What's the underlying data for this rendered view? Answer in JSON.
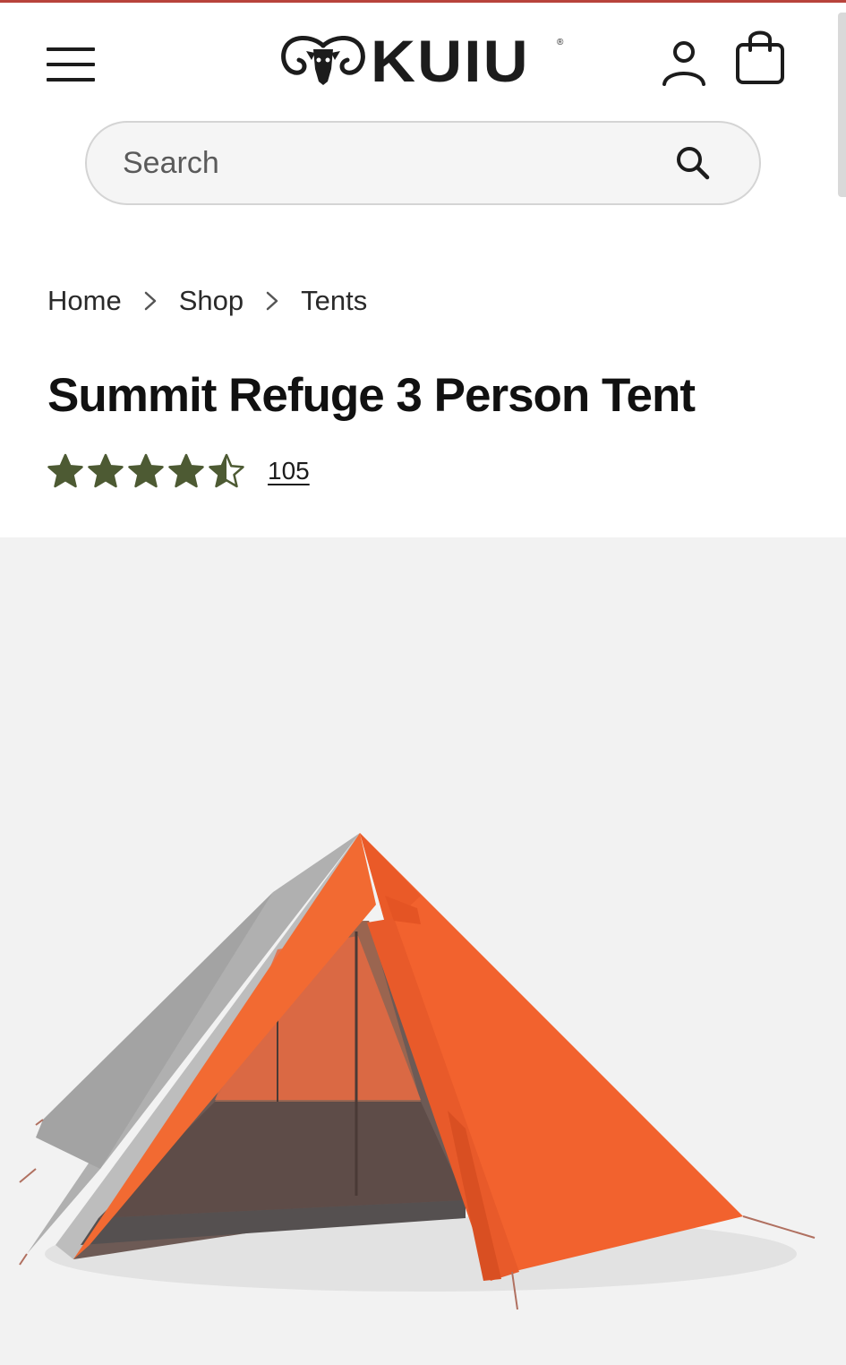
{
  "header": {
    "brand": "KUIU",
    "brand_mark": "®",
    "menu_icon": "hamburger-menu-icon",
    "account_icon": "user-icon",
    "cart_icon": "shopping-bag-icon"
  },
  "search": {
    "placeholder": "Search",
    "value": "",
    "icon": "search-icon"
  },
  "breadcrumb": {
    "items": [
      {
        "label": "Home"
      },
      {
        "label": "Shop"
      },
      {
        "label": "Tents"
      }
    ],
    "separator_icon": "chevron-right-icon"
  },
  "product": {
    "title": "Summit Refuge 3 Person Tent",
    "rating": 4.5,
    "rating_max": 5,
    "review_count": "105",
    "image_icon": "tent-product-image"
  },
  "colors": {
    "star": "#4d5a33",
    "accent_top_rule": "#b8433b",
    "tent_orange": "#f2622e",
    "tent_gray": "#a8a8a8",
    "media_background": "#f2f2f2"
  }
}
